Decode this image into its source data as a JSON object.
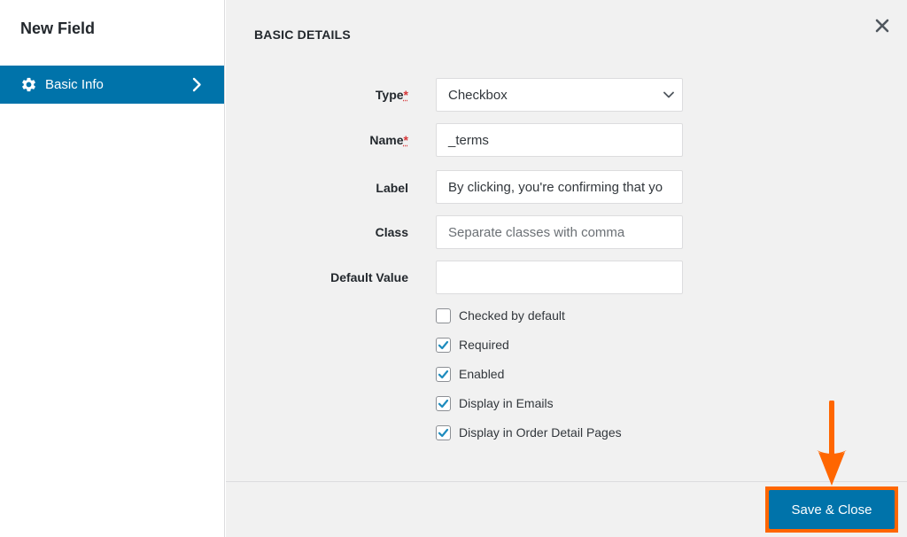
{
  "sidebar": {
    "title": "New Field",
    "items": [
      {
        "label": "Basic Info",
        "icon": "gear-icon",
        "active": true
      }
    ]
  },
  "main": {
    "section_title": "BASIC DETAILS",
    "fields": {
      "type": {
        "label": "Type",
        "required_mark": "*",
        "value": "Checkbox"
      },
      "name": {
        "label": "Name",
        "required_mark": "*",
        "value": "_terms"
      },
      "label": {
        "label": "Label",
        "value": "By clicking, you're confirming that yo"
      },
      "class": {
        "label": "Class",
        "placeholder": "Separate classes with comma"
      },
      "default_value": {
        "label": "Default Value",
        "value": ""
      }
    },
    "checkboxes": [
      {
        "label": "Checked by default",
        "checked": false
      },
      {
        "label": "Required",
        "checked": true
      },
      {
        "label": "Enabled",
        "checked": true
      },
      {
        "label": "Display in Emails",
        "checked": true
      },
      {
        "label": "Display in Order Detail Pages",
        "checked": true
      }
    ]
  },
  "footer": {
    "save_label": "Save & Close"
  },
  "colors": {
    "accent": "#0073aa",
    "highlight": "#ff6600",
    "required": "#d63638"
  }
}
